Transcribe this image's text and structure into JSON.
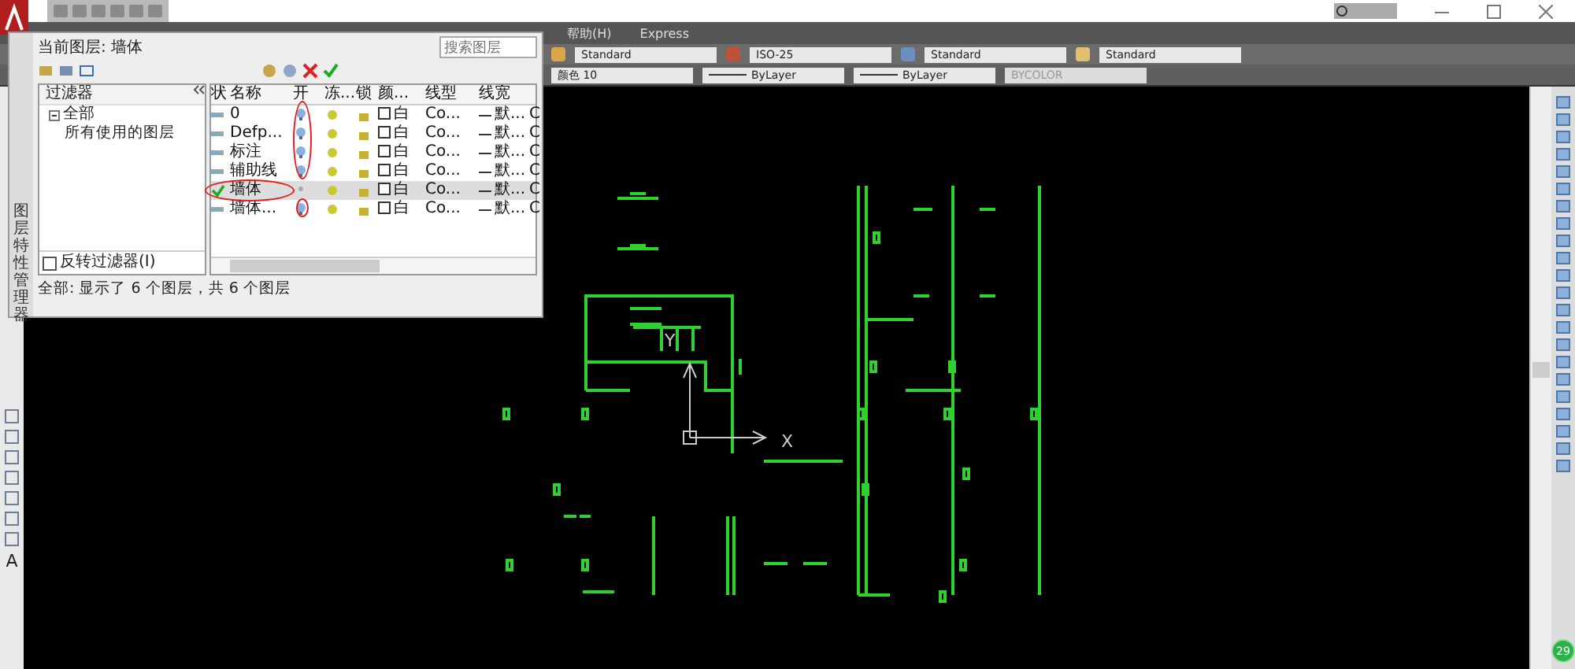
{
  "menu_bar": {
    "items": [
      "帮助(H)",
      "Express"
    ]
  },
  "toolbar": {
    "row1": [
      {
        "kind": "style",
        "value": "Standard"
      },
      {
        "kind": "dim",
        "value": "ISO-25"
      },
      {
        "kind": "table",
        "value": "Standard"
      },
      {
        "kind": "mleader",
        "value": "Standard"
      }
    ],
    "row2": [
      {
        "kind": "color",
        "value": "颜色 10",
        "disabled": false
      },
      {
        "kind": "linetype",
        "value": "ByLayer",
        "disabled": false
      },
      {
        "kind": "linetype",
        "value": "ByLayer",
        "disabled": false
      },
      {
        "kind": "plain",
        "value": "BYCOLOR",
        "disabled": true
      }
    ]
  },
  "layer_palette": {
    "side_title": "图层特性管理器",
    "current_layer": "当前图层: 墙体",
    "search": {
      "placeholder": "搜索图层"
    },
    "filter_header": "过滤器",
    "filter_tree": [
      {
        "label": "全部",
        "expanded": true,
        "children": [
          {
            "label": "所有使用的图层"
          }
        ]
      }
    ],
    "invert_filter": {
      "label": "反转过滤器(I)",
      "checked": false
    },
    "columns": [
      "状",
      "名称",
      "开",
      "冻...",
      "锁",
      "颜...",
      "线型",
      "线宽"
    ],
    "rows": [
      {
        "name": "0",
        "current": false,
        "selected": false,
        "on": true,
        "color_name": "白",
        "linetype": "Co...",
        "lineweight": "默...",
        "column_9": "C"
      },
      {
        "name": "Defp...",
        "current": false,
        "selected": false,
        "on": true,
        "color_name": "白",
        "linetype": "Co...",
        "lineweight": "默...",
        "column_9": "C"
      },
      {
        "name": "标注",
        "current": false,
        "selected": false,
        "on": true,
        "color_name": "白",
        "linetype": "Co...",
        "lineweight": "默...",
        "column_9": "C"
      },
      {
        "name": "辅助线",
        "current": false,
        "selected": false,
        "on": true,
        "color_name": "白",
        "linetype": "Co...",
        "lineweight": "默...",
        "column_9": "C"
      },
      {
        "name": "墙体",
        "current": true,
        "selected": true,
        "on": false,
        "color_name": "白",
        "linetype": "Co...",
        "lineweight": "默...",
        "column_9": "C"
      },
      {
        "name": "墙体...",
        "current": false,
        "selected": false,
        "on": true,
        "color_name": "白",
        "linetype": "Co...",
        "lineweight": "默...",
        "column_9": "C"
      }
    ],
    "status": "全部: 显示了 6 个图层，共 6 个图层"
  },
  "left_toolbar": {
    "text_tool": "A"
  },
  "canvas": {
    "axis_x": "X",
    "axis_y": "Y"
  },
  "badge": "29"
}
